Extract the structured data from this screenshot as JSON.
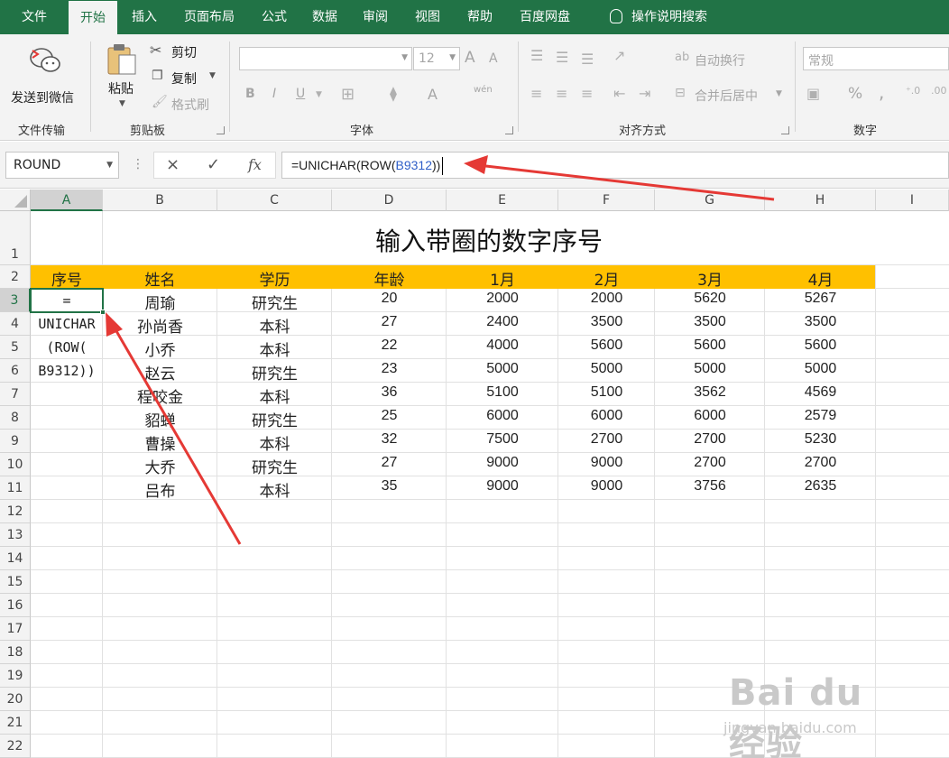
{
  "tabs": [
    "文件",
    "开始",
    "插入",
    "页面布局",
    "公式",
    "数据",
    "审阅",
    "视图",
    "帮助",
    "百度网盘",
    "操作说明搜索"
  ],
  "ribbon": {
    "wechat": {
      "label": "发送到微信",
      "group": "文件传输"
    },
    "clipboard": {
      "paste": "粘贴",
      "cut": "剪切",
      "copy": "复制",
      "format_painter": "格式刷",
      "group": "剪贴板"
    },
    "font": {
      "name": "",
      "size": "12",
      "group": "字体",
      "bold": "B",
      "italic": "I",
      "underline": "U",
      "grow": "A",
      "shrink": "A",
      "color": "A",
      "phonetic": "wén"
    },
    "align": {
      "wrap": "自动换行",
      "merge": "合并后居中",
      "group": "对齐方式"
    },
    "number": {
      "format": "常规",
      "group": "数字",
      "percent": "%",
      "comma": ","
    }
  },
  "formula_bar": {
    "name_box": "ROUND",
    "formula_prefix": "=UNICHAR(ROW(",
    "formula_ref": "B9312",
    "formula_suffix": "))",
    "cancel_icon": "×",
    "enter_icon": "✓",
    "fx_icon": "fx"
  },
  "sheet": {
    "columns": [
      "A",
      "B",
      "C",
      "D",
      "E",
      "F",
      "G",
      "H",
      "I"
    ],
    "rows": [
      "1",
      "2",
      "3",
      "4",
      "5",
      "6",
      "7",
      "8",
      "9",
      "10",
      "11",
      "12",
      "13",
      "14",
      "15",
      "16",
      "17",
      "18",
      "19",
      "20",
      "21",
      "22"
    ],
    "title": "输入带圈的数字序号",
    "header": [
      "序号",
      "姓名",
      "学历",
      "年龄",
      "1月",
      "2月",
      "3月",
      "4月"
    ],
    "data": [
      [
        "周瑜",
        "研究生",
        "20",
        "2000",
        "2000",
        "5620",
        "5267"
      ],
      [
        "孙尚香",
        "本科",
        "27",
        "2400",
        "3500",
        "3500",
        "3500"
      ],
      [
        "小乔",
        "本科",
        "22",
        "4000",
        "5600",
        "5600",
        "5600"
      ],
      [
        "赵云",
        "研究生",
        "23",
        "5000",
        "5000",
        "5000",
        "5000"
      ],
      [
        "程咬金",
        "本科",
        "36",
        "5100",
        "5100",
        "3562",
        "4569"
      ],
      [
        "貂蝉",
        "研究生",
        "25",
        "6000",
        "6000",
        "6000",
        "2579"
      ],
      [
        "曹操",
        "本科",
        "32",
        "7500",
        "2700",
        "2700",
        "5230"
      ],
      [
        "大乔",
        "研究生",
        "27",
        "9000",
        "9000",
        "2700",
        "2700"
      ],
      [
        "吕布",
        "本科",
        "35",
        "9000",
        "9000",
        "3756",
        "2635"
      ]
    ],
    "editing_text_lines": [
      "=",
      "UNICHAR",
      "(ROW(",
      "B9312))"
    ]
  },
  "watermark": {
    "brand": "Bai du 经验",
    "url": "jingyan.baidu.com"
  },
  "colors": {
    "excel_green": "#217346",
    "header_fill": "#ffc000",
    "arrow": "#e53935",
    "ref_blue": "#2f5fc8"
  }
}
